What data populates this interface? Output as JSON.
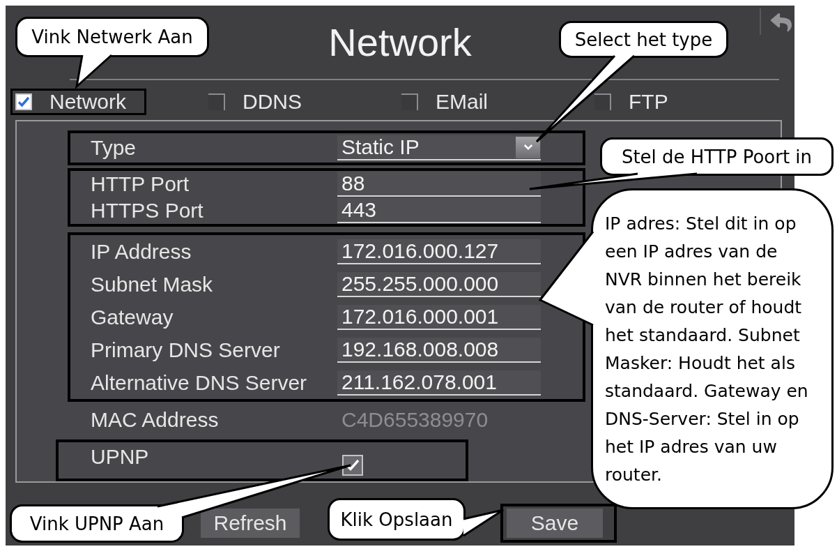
{
  "window": {
    "title": "Network"
  },
  "tabs": [
    {
      "label": "Network",
      "checked": true,
      "highlighted": true
    },
    {
      "label": "DDNS",
      "checked": false,
      "highlighted": false
    },
    {
      "label": "EMail",
      "checked": false,
      "highlighted": false
    },
    {
      "label": "FTP",
      "checked": false,
      "highlighted": false
    }
  ],
  "groups": [
    {
      "highlighted": true,
      "rows": [
        {
          "kind": "dropdown",
          "label": "Type",
          "value": "Static IP"
        }
      ]
    },
    {
      "highlighted": true,
      "rows": [
        {
          "kind": "input",
          "label": "HTTP Port",
          "value": "88"
        },
        {
          "kind": "input",
          "label": "HTTPS Port",
          "value": "443"
        }
      ]
    },
    {
      "highlighted": true,
      "rows": [
        {
          "kind": "input",
          "label": "IP Address",
          "value": "172.016.000.127"
        },
        {
          "kind": "input",
          "label": "Subnet Mask",
          "value": "255.255.000.000"
        },
        {
          "kind": "input",
          "label": "Gateway",
          "value": "172.016.000.001"
        },
        {
          "kind": "input",
          "label": "Primary DNS Server",
          "value": "192.168.008.008"
        },
        {
          "kind": "input",
          "label": "Alternative DNS Server",
          "value": "211.162.078.001"
        }
      ]
    },
    {
      "highlighted": false,
      "rows": [
        {
          "kind": "readonly",
          "label": "MAC Address",
          "value": "C4D655389970"
        }
      ]
    },
    {
      "highlighted": true,
      "rows": [
        {
          "kind": "checkbox",
          "label": "UPNP",
          "checked": true
        }
      ]
    }
  ],
  "buttons": [
    {
      "label": "Refresh",
      "highlighted": false
    },
    {
      "label": "Save",
      "highlighted": true
    }
  ],
  "callouts": [
    "Vink Netwerk Aan",
    "Select het type",
    "Stel de HTTP Poort in",
    "IP adres: Stel dit in op een IP adres van de NVR binnen het bereik van de router of houdt het standaard. Subnet Masker: Houdt het als standaard. Gateway en DNS-Server: Stel in op het IP adres van uw router.",
    "Vink UPNP Aan",
    "Klik Opslaan"
  ]
}
